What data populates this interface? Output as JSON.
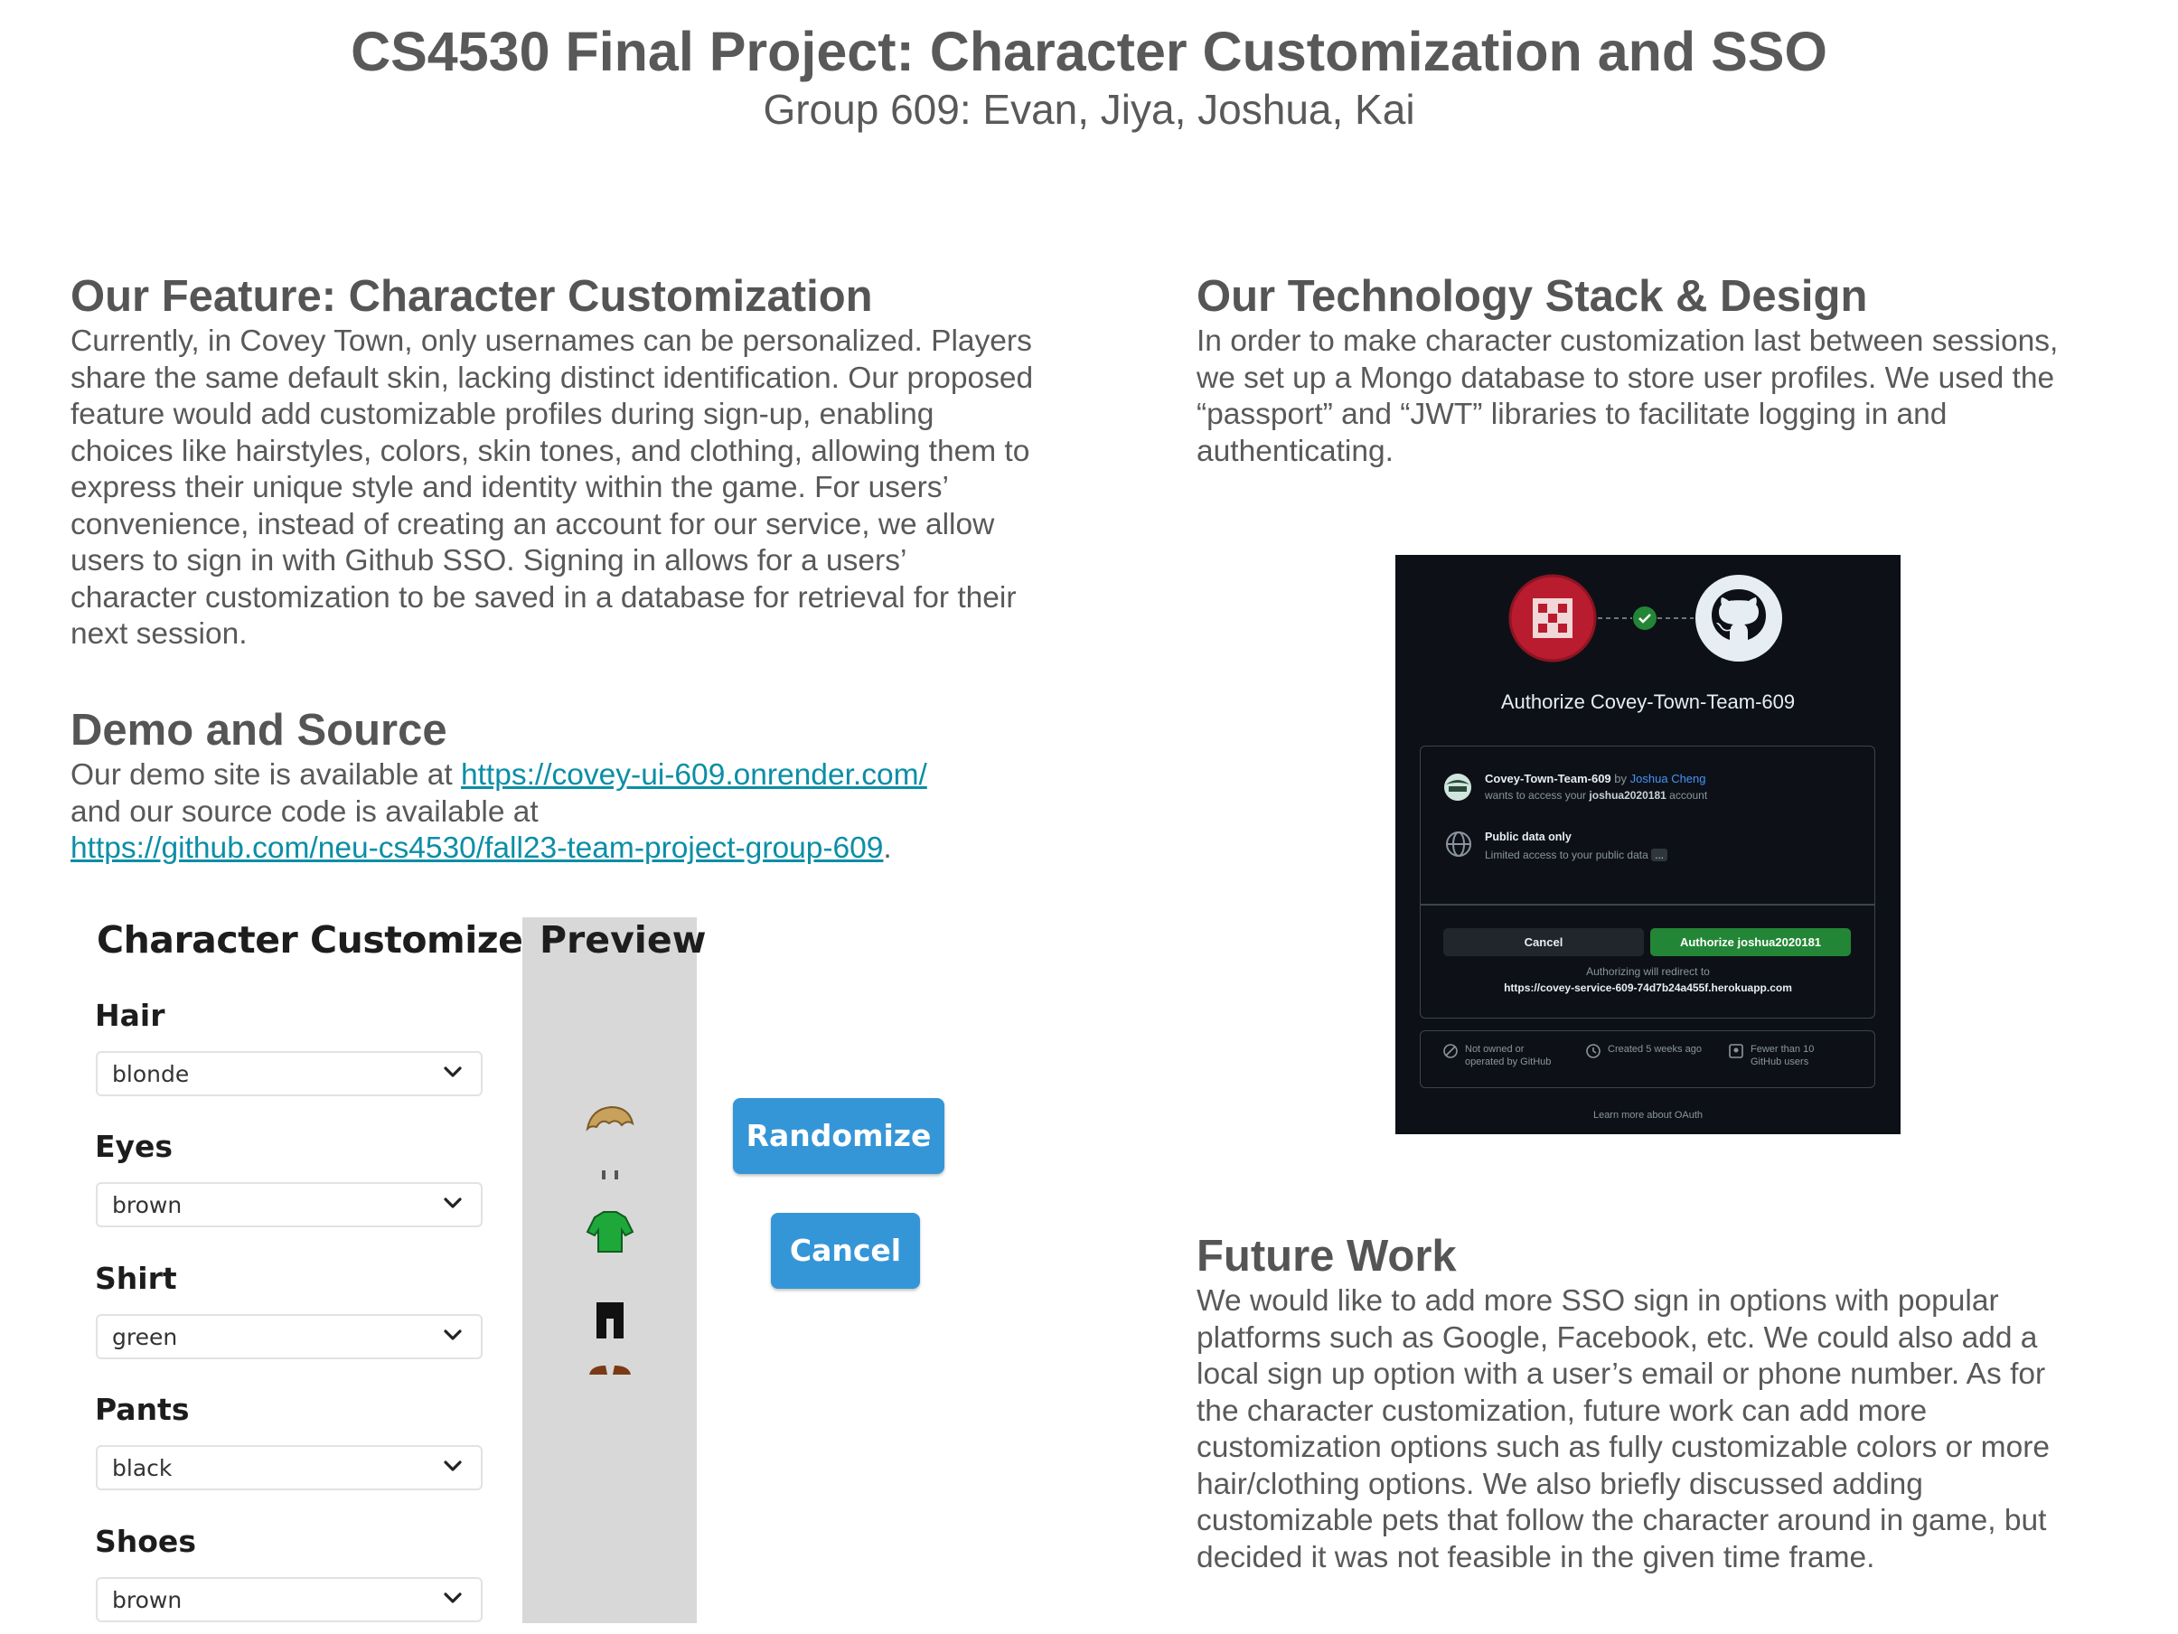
{
  "header": {
    "title": "CS4530 Final Project: Character Customization and SSO",
    "subtitle": "Group 609: Evan, Jiya, Joshua, Kai"
  },
  "feature": {
    "heading": "Our Feature: Character Customization",
    "lines": [
      "Currently, in Covey Town, only usernames can be personalized. Players",
      "share the same default skin, lacking distinct identification. Our proposed",
      "feature would add customizable profiles during sign-up, enabling",
      "choices like hairstyles, colors, skin tones, and clothing, allowing them to",
      "express their unique style and identity within the game. For users’",
      "convenience, instead of creating an account for our service, we allow",
      "users to sign in with Github SSO. Signing in allows for a users’",
      "character customization to be saved in a database for retrieval for their",
      "next session."
    ]
  },
  "demo": {
    "heading": "Demo and Source",
    "line1_prefix": "Our demo site is available at ",
    "demo_link": "https://covey-ui-609.onrender.com/",
    "line2": "and our source code is available at",
    "source_link": "https://github.com/neu-cs4530/fall23-team-project-group-609",
    "line3_suffix": "."
  },
  "customizer": {
    "title": "Character Customizer",
    "preview_title": "Preview",
    "fields": [
      {
        "label": "Hair",
        "value": "blonde"
      },
      {
        "label": "Eyes",
        "value": "brown"
      },
      {
        "label": "Shirt",
        "value": "green"
      },
      {
        "label": "Pants",
        "value": "black"
      },
      {
        "label": "Shoes",
        "value": "brown"
      }
    ],
    "randomize_label": "Randomize",
    "cancel_label": "Cancel"
  },
  "tech": {
    "heading": "Our Technology Stack & Design",
    "lines": [
      "In order to make character customization last between sessions,",
      "we set up a Mongo database to store user profiles. We used the",
      "“passport” and “JWT” libraries to facilitate logging in and",
      "authenticating."
    ]
  },
  "oauth": {
    "title": "Authorize Covey-Town-Team-609",
    "app_name": "Covey-Town-Team-609",
    "by": "by",
    "owner": "Joshua Cheng",
    "wants_prefix": "wants to access your",
    "account_name": "joshua2020181",
    "wants_suffix": "account",
    "scope_title": "Public data only",
    "scope_desc": "Limited access to your public data",
    "scope_more": "...",
    "cancel_label": "Cancel",
    "authorize_label": "Authorize joshua2020181",
    "redirect_note": "Authorizing will redirect to",
    "redirect_url": "https://covey-service-609-74d7b24a455f.herokuapp.com",
    "footer": [
      {
        "line1": "Not owned or",
        "line2": "operated by GitHub"
      },
      {
        "line1": "Created 5 weeks ago",
        "line2": ""
      },
      {
        "line1": "Fewer than 10",
        "line2": "GitHub users"
      }
    ],
    "learn_more": "Learn more about OAuth",
    "colors": {
      "bg": "#0d1117",
      "green": "#238636",
      "link": "#4493f8",
      "app_red": "#b91c2e"
    }
  },
  "future": {
    "heading": "Future Work",
    "lines": [
      "We would like to add more SSO sign in options with popular",
      "platforms such as Google, Facebook, etc. We could also add a",
      "local sign up option with a user’s email or phone number. As for",
      "the character customization, future work can add more",
      "customization options such as fully customizable colors or more",
      "hair/clothing options. We also briefly discussed adding",
      "customizable pets that follow the character around in game, but",
      "decided it was not feasible in the given time frame."
    ]
  }
}
